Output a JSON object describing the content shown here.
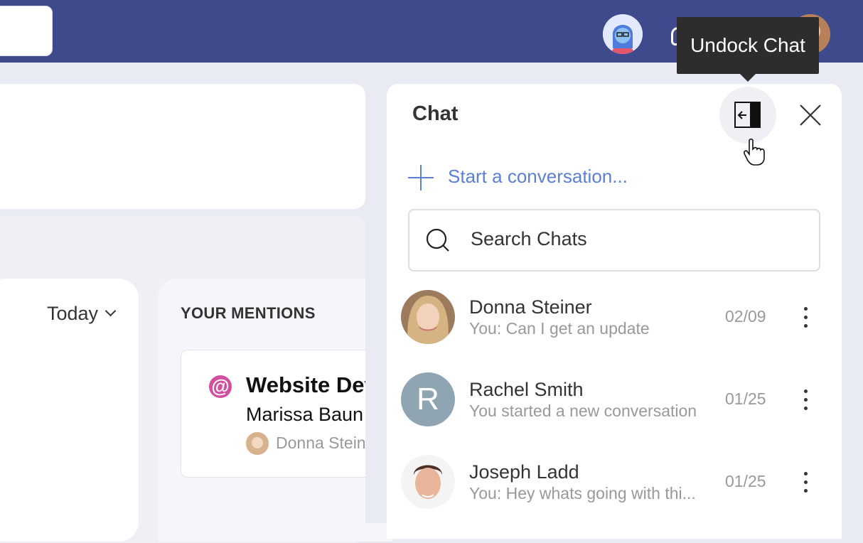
{
  "topbar": {
    "tooltip": "Undock Chat"
  },
  "dashboard": {
    "today_filter": "Today",
    "mentions_title": "YOUR MENTIONS",
    "mention": {
      "title": "Website Dev",
      "subtitle": "Marissa Baun",
      "author": "Donna Stein"
    }
  },
  "chat": {
    "title": "Chat",
    "start_label": "Start a conversation...",
    "search_placeholder": "Search Chats",
    "conversations": [
      {
        "name": "Donna Steiner",
        "preview": "You: Can I get an update",
        "date": "02/09",
        "initial": ""
      },
      {
        "name": "Rachel Smith",
        "preview": "You started a new conversation",
        "date": "01/25",
        "initial": "R"
      },
      {
        "name": "Joseph Ladd",
        "preview": "You: Hey whats going with thi...",
        "date": "01/25",
        "initial": ""
      }
    ]
  },
  "colors": {
    "topbar": "#3f4a8c",
    "accent": "#5b7fd6",
    "mention_icon": "#d44e9e"
  }
}
